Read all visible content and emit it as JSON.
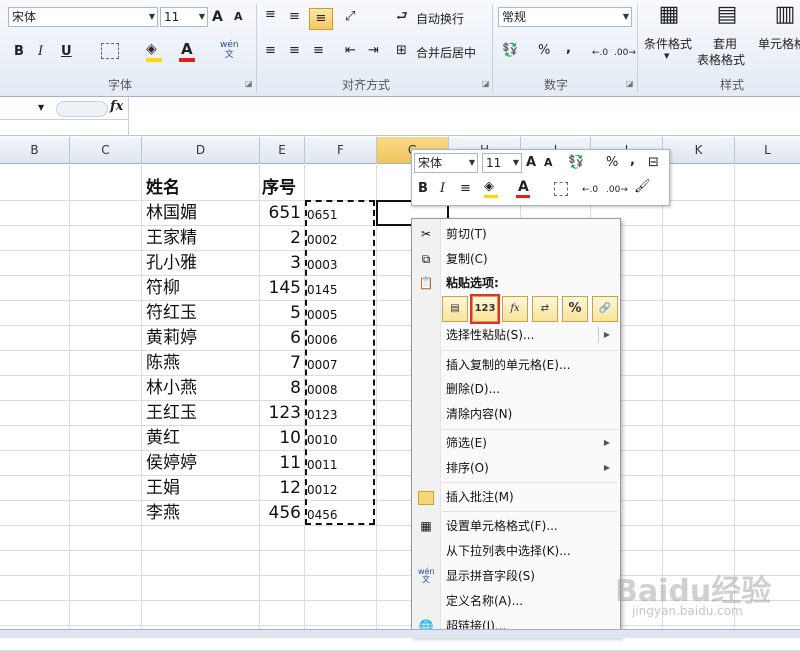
{
  "ribbon": {
    "font_name": "宋体",
    "font_size": "11",
    "grow_font": "A",
    "shrink_font": "A",
    "bold": "B",
    "italic": "I",
    "underline": "U",
    "font_color_letter": "A",
    "phonetic": "wén\n文",
    "wrap_text": "自动换行",
    "merge_center": "合并后居中",
    "number_format": "常规",
    "percent": "%",
    "comma": ",",
    "conditional_format": "条件格式",
    "table_format_line1": "套用",
    "table_format_line2": "表格格式",
    "cell_styles": "单元格格",
    "group_font": "字体",
    "group_alignment": "对齐方式",
    "group_number": "数字",
    "group_styles": "样式"
  },
  "formula_bar": {
    "fx": "fx"
  },
  "columns": [
    "B",
    "C",
    "D",
    "E",
    "F",
    "G",
    "H",
    "I",
    "J",
    "K",
    "L"
  ],
  "sheet": {
    "header_name": "姓名",
    "header_num": "序号",
    "rows": [
      {
        "name": "林国媚",
        "num": "651",
        "code": "0651"
      },
      {
        "name": "王家精",
        "num": "2",
        "code": "0002"
      },
      {
        "name": "孔小雅",
        "num": "3",
        "code": "0003"
      },
      {
        "name": "符柳",
        "num": "145",
        "code": "0145"
      },
      {
        "name": "符红玉",
        "num": "5",
        "code": "0005"
      },
      {
        "name": "黄莉婷",
        "num": "6",
        "code": "0006"
      },
      {
        "name": "陈燕",
        "num": "7",
        "code": "0007"
      },
      {
        "name": "林小燕",
        "num": "8",
        "code": "0008"
      },
      {
        "name": "王红玉",
        "num": "123",
        "code": "0123"
      },
      {
        "name": "黄红",
        "num": "10",
        "code": "0010"
      },
      {
        "name": "侯婷婷",
        "num": "11",
        "code": "0011"
      },
      {
        "name": "王娟",
        "num": "12",
        "code": "0012"
      },
      {
        "name": "李燕",
        "num": "456",
        "code": "0456"
      }
    ]
  },
  "mini_toolbar": {
    "font_name": "宋体",
    "font_size": "11",
    "percent": "%",
    "comma": ",",
    "bold": "B",
    "italic": "I",
    "font_color_letter": "A"
  },
  "context_menu": {
    "cut": "剪切(T)",
    "copy": "复制(C)",
    "paste_options": "粘贴选项:",
    "paste_buttons": [
      "paste-icon",
      "123",
      "fx",
      "transpose-icon",
      "%",
      "link-icon"
    ],
    "paste_special": "选择性粘贴(S)...",
    "insert_copied": "插入复制的单元格(E)...",
    "delete": "删除(D)...",
    "clear": "清除内容(N)",
    "filter": "筛选(E)",
    "sort": "排序(O)",
    "insert_comment": "插入批注(M)",
    "format_cells": "设置单元格格式(F)...",
    "pick_from_list": "从下拉列表中选择(K)...",
    "show_phonetic": "显示拼音字段(S)",
    "define_name": "定义名称(A)...",
    "hyperlink": "超链接(I)..."
  },
  "watermark": "Baidu经验",
  "watermark_url": "jingyan.baidu.com",
  "colors": {
    "accent_selected": "#f3c45b",
    "highlight_border": "#e03030",
    "font_red": "#e02020",
    "fill_yellow": "#ffd800"
  }
}
